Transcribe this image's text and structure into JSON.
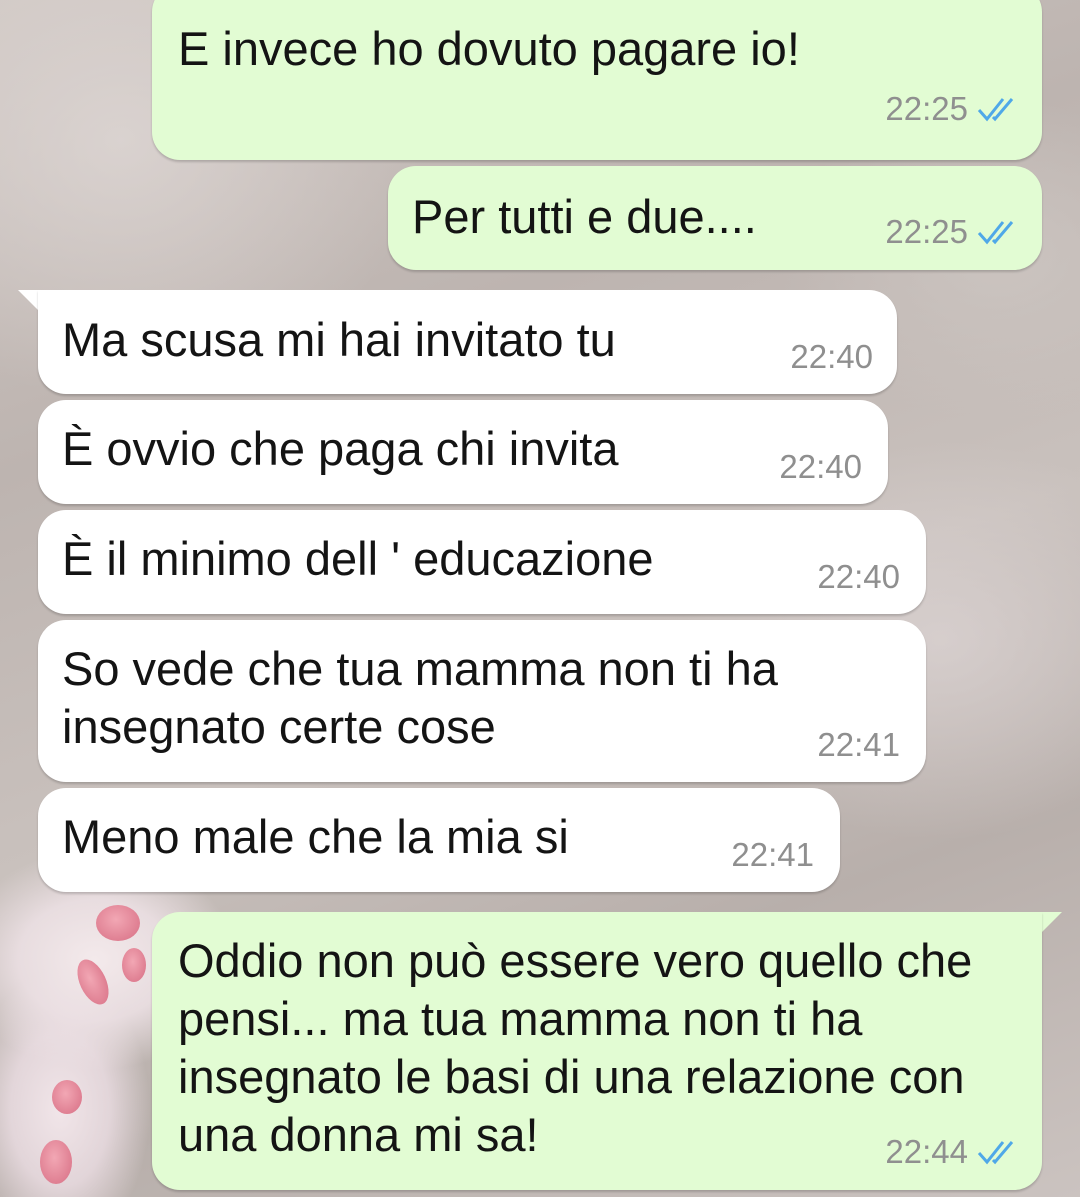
{
  "colors": {
    "outgoing_bubble": "#e2fcd3",
    "incoming_bubble": "#ffffff",
    "read_ticks": "#4fa8e8",
    "timestamp": "#8f8f8f"
  },
  "messages": [
    {
      "direction": "outgoing",
      "text": "E invece ho dovuto pagare io!",
      "time": "22:25",
      "status_icon": "double-check-read-icon"
    },
    {
      "direction": "outgoing",
      "text": "Per tutti e due....",
      "time": "22:25",
      "status_icon": "double-check-read-icon"
    },
    {
      "direction": "incoming",
      "text": "Ma scusa mi hai invitato tu",
      "time": "22:40"
    },
    {
      "direction": "incoming",
      "text": "È ovvio che paga chi invita",
      "time": "22:40"
    },
    {
      "direction": "incoming",
      "text": "È il minimo dell ' educazione",
      "time": "22:40"
    },
    {
      "direction": "incoming",
      "text": "So vede che tua mamma non ti ha\ninsegnato certe cose",
      "time": "22:41"
    },
    {
      "direction": "incoming",
      "text": "Meno male che la mia si",
      "time": "22:41"
    },
    {
      "direction": "outgoing",
      "text": "Oddio non può essere vero quello che\npensi... ma tua mamma  non ti ha\ninsegnato le basi di una relazione con\nuna donna mi sa!",
      "time": "22:44",
      "status_icon": "double-check-read-icon"
    }
  ]
}
